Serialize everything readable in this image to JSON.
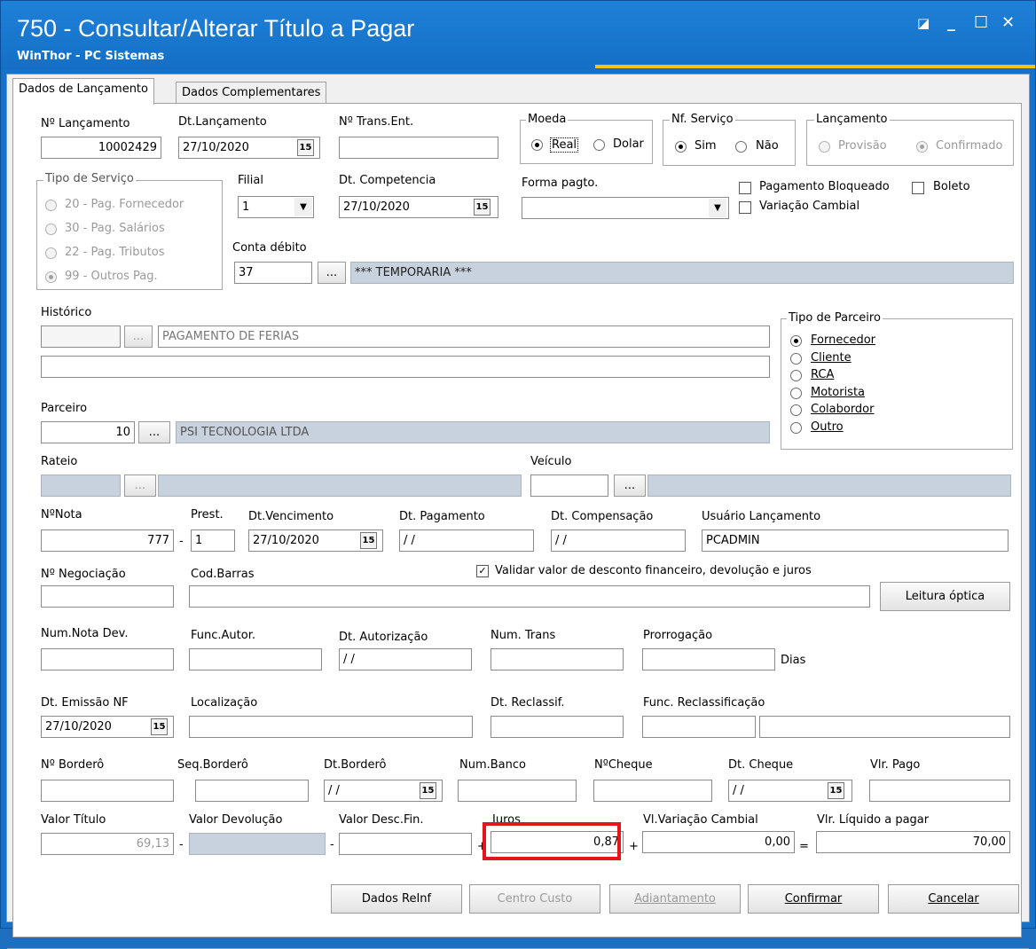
{
  "window": {
    "title": "750 - Consultar/Alterar Título a Pagar",
    "subtitle": "WinThor - PC Sistemas"
  },
  "tabs": [
    "Dados de Lançamento",
    "Dados Complementares"
  ],
  "f": {
    "nlanc_l": "Nº Lançamento",
    "nlanc": "10002429",
    "dtlanc_l": "Dt.Lançamento",
    "dtlanc": "27/10/2020",
    "ntrans_l": "Nº Trans.Ent.",
    "ntrans": "",
    "moeda_l": "Moeda",
    "moeda_real": "Real",
    "moeda_dolar": "Dolar",
    "nfs_l": "Nf. Serviço",
    "nfs_sim": "Sim",
    "nfs_nao": "Não",
    "lanc_l": "Lançamento",
    "lanc_prov": "Provisão",
    "lanc_conf": "Confirmado",
    "tipo_l": "Tipo de Serviço",
    "t20": "20 - Pag. Fornecedor",
    "t30": "30 - Pag. Salários",
    "t22": "22 - Pag. Tributos",
    "t99": "99 - Outros Pag.",
    "filial_l": "Filial",
    "filial": "1",
    "dtcomp_l": "Dt. Competencia",
    "dtcomp": "27/10/2020",
    "forma_l": "Forma pagto.",
    "forma": "",
    "pagbloq": "Pagamento Bloqueado",
    "boleto": "Boleto",
    "varcamb": "Variação Cambial",
    "conta_l": "Conta débito",
    "conta": "37",
    "conta_desc": "*** TEMPORARIA ***",
    "hist_l": "Histórico",
    "hist_cod": "",
    "hist_desc": "PAGAMENTO DE FERIAS",
    "hist2": "",
    "parc_l": "Tipo de Parceiro",
    "p1": "Fornecedor",
    "p2": "Cliente",
    "p3": "RCA",
    "p4": "Motorista",
    "p5": "Colabordor",
    "p6": "Outro",
    "parceiro_l": "Parceiro",
    "parceiro": "10",
    "parceiro_desc": "PSI TECNOLOGIA LTDA",
    "rateio_l": "Rateio",
    "veiculo_l": "Veículo",
    "nnota_l": "NºNota",
    "nnota": "777",
    "prest_l": "Prest.",
    "prest": "1",
    "dtvenc_l": "Dt.Vencimento",
    "dtvenc": "27/10/2020",
    "dtpag_l": "Dt. Pagamento",
    "dtpag": "/ /",
    "dtcomps_l": "Dt. Compensação",
    "dtcomps": "/ /",
    "usr_l": "Usuário Lançamento",
    "usr": "PCADMIN",
    "nneg_l": "Nº Negociação",
    "codbar_l": "Cod.Barras",
    "validar": "Validar valor de desconto financeiro,  devolução e juros",
    "leitura": "Leitura óptica",
    "numdev_l": "Num.Nota Dev.",
    "funcaut_l": "Func.Autor.",
    "dtaut_l": "Dt. Autorização",
    "dtaut": "/ /",
    "numtrans_l": "Num. Trans",
    "prorr_l": "Prorrogação",
    "dias": "Dias",
    "dtemis_l": "Dt. Emissão NF",
    "dtemis": "27/10/2020",
    "local_l": "Localização",
    "dtrecl_l": "Dt. Reclassif.",
    "funcrecl_l": "Func. Reclassificação",
    "nbord_l": "Nº Borderô",
    "seqbord_l": "Seq.Borderô",
    "dtbord_l": "Dt.Borderô",
    "dtbord": "/ /",
    "numbanco_l": "Num.Banco",
    "ncheque_l": "NºCheque",
    "dtcheque_l": "Dt. Cheque",
    "dtcheque": "/ /",
    "vlpago_l": "Vlr. Pago",
    "valtit_l": "Valor Título",
    "valtit": "69,13",
    "valdev_l": "Valor Devolução",
    "valdesc_l": "Valor Desc.Fin.",
    "juros_l": "Juros",
    "juros": "0,87",
    "vlvar_l": "Vl.Variação Cambial",
    "vlvar": "0,00",
    "vlliq_l": "Vlr. Líquido a pagar",
    "vlliq": "70,00",
    "op_minus": "-",
    "op_plus": "+",
    "op_eq": "="
  },
  "buttons": {
    "reinf": "Dados ReInf",
    "centro": "Centro Custo",
    "adiant": "Adiantamento",
    "confirmar": "Confirmar",
    "cancelar": "Cancelar"
  },
  "colors": {
    "titlebar": "#1672c9",
    "highlight": "#e0181a"
  }
}
